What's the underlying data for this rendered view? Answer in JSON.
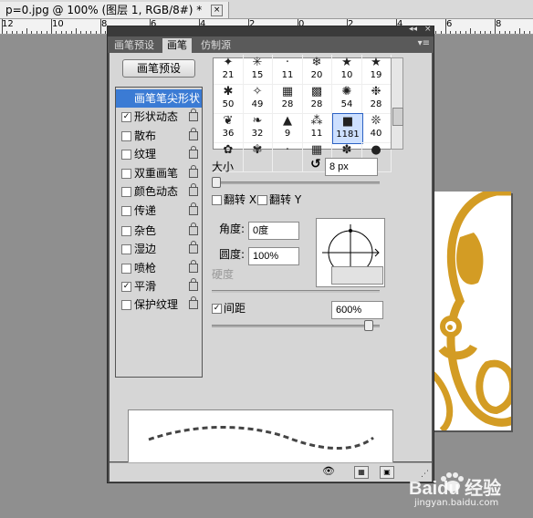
{
  "document_tab": {
    "title": "p=0.jpg @ 100% (图层 1, RGB/8#) *",
    "close": "×"
  },
  "ruler": {
    "labels": [
      "12",
      "10",
      "8",
      "6",
      "4",
      "2",
      "0",
      "2",
      "4",
      "6",
      "8"
    ]
  },
  "panel": {
    "collapse_glyph": "◂◂",
    "close_glyph": "×",
    "menu_glyph": "▾≡",
    "tabs": [
      "画笔预设",
      "画笔",
      "仿制源"
    ],
    "active_tab": 1,
    "brush_presets_button": "画笔预设",
    "options": [
      {
        "label": "画笔笔尖形状",
        "checked": null,
        "lock": false,
        "header": true
      },
      {
        "label": "形状动态",
        "checked": true,
        "lock": true
      },
      {
        "label": "散布",
        "checked": false,
        "lock": true
      },
      {
        "label": "纹理",
        "checked": false,
        "lock": true
      },
      {
        "label": "双重画笔",
        "checked": false,
        "lock": true
      },
      {
        "label": "颜色动态",
        "checked": false,
        "lock": true
      },
      {
        "label": "传递",
        "checked": false,
        "lock": true
      },
      {
        "label": "杂色",
        "checked": false,
        "lock": true
      },
      {
        "label": "湿边",
        "checked": false,
        "lock": true
      },
      {
        "label": "喷枪",
        "checked": false,
        "lock": true
      },
      {
        "label": "平滑",
        "checked": true,
        "lock": true
      },
      {
        "label": "保护纹理",
        "checked": false,
        "lock": true
      }
    ],
    "brushes": [
      {
        "glyph": "✦",
        "size": "21"
      },
      {
        "glyph": "✳",
        "size": "15"
      },
      {
        "glyph": "·",
        "size": "11"
      },
      {
        "glyph": "❄",
        "size": "20"
      },
      {
        "glyph": "★",
        "size": "10"
      },
      {
        "glyph": "★",
        "size": "19"
      },
      {
        "glyph": "✱",
        "size": "50"
      },
      {
        "glyph": "✧",
        "size": "49"
      },
      {
        "glyph": "▦",
        "size": "28"
      },
      {
        "glyph": "▩",
        "size": "28"
      },
      {
        "glyph": "✺",
        "size": "54"
      },
      {
        "glyph": "❉",
        "size": "28"
      },
      {
        "glyph": "❦",
        "size": "36"
      },
      {
        "glyph": "❧",
        "size": "32"
      },
      {
        "glyph": "▲",
        "size": "9"
      },
      {
        "glyph": "⁂",
        "size": "11"
      },
      {
        "glyph": "■",
        "size": "1181"
      },
      {
        "glyph": "❊",
        "size": "40"
      },
      {
        "glyph": "✿",
        "size": ""
      },
      {
        "glyph": "✾",
        "size": ""
      },
      {
        "glyph": "·",
        "size": ""
      },
      {
        "glyph": "▦",
        "size": ""
      },
      {
        "glyph": "✽",
        "size": ""
      },
      {
        "glyph": "●",
        "size": ""
      }
    ],
    "selected_brush": 16,
    "size_label": "大小",
    "reset_icon_glyph": "↺",
    "size_value": "8 px",
    "flip_x_label": "翻转 X",
    "flip_y_label": "翻转 Y",
    "angle_label": "角度:",
    "angle_value": "0度",
    "roundness_label": "圆度:",
    "roundness_value": "100%",
    "hardness_label": "硬度",
    "hardness_value": "",
    "spacing_checked": true,
    "spacing_label": "间距",
    "spacing_value": "600%",
    "size_slider_fraction": 0.02,
    "spacing_slider_fraction": 0.93,
    "footer_icons": [
      "eye-brush",
      "grid",
      "new-preset"
    ]
  },
  "watermark": {
    "brand": "Baidu 经验",
    "url": "jingyan.baidu.com"
  },
  "colors": {
    "accent": "#3b7bd4",
    "panel_dark": "#4f4f4f",
    "panel_light": "#d6d6d6",
    "canvas": "#8f8f8f",
    "art": "#d39c24"
  }
}
